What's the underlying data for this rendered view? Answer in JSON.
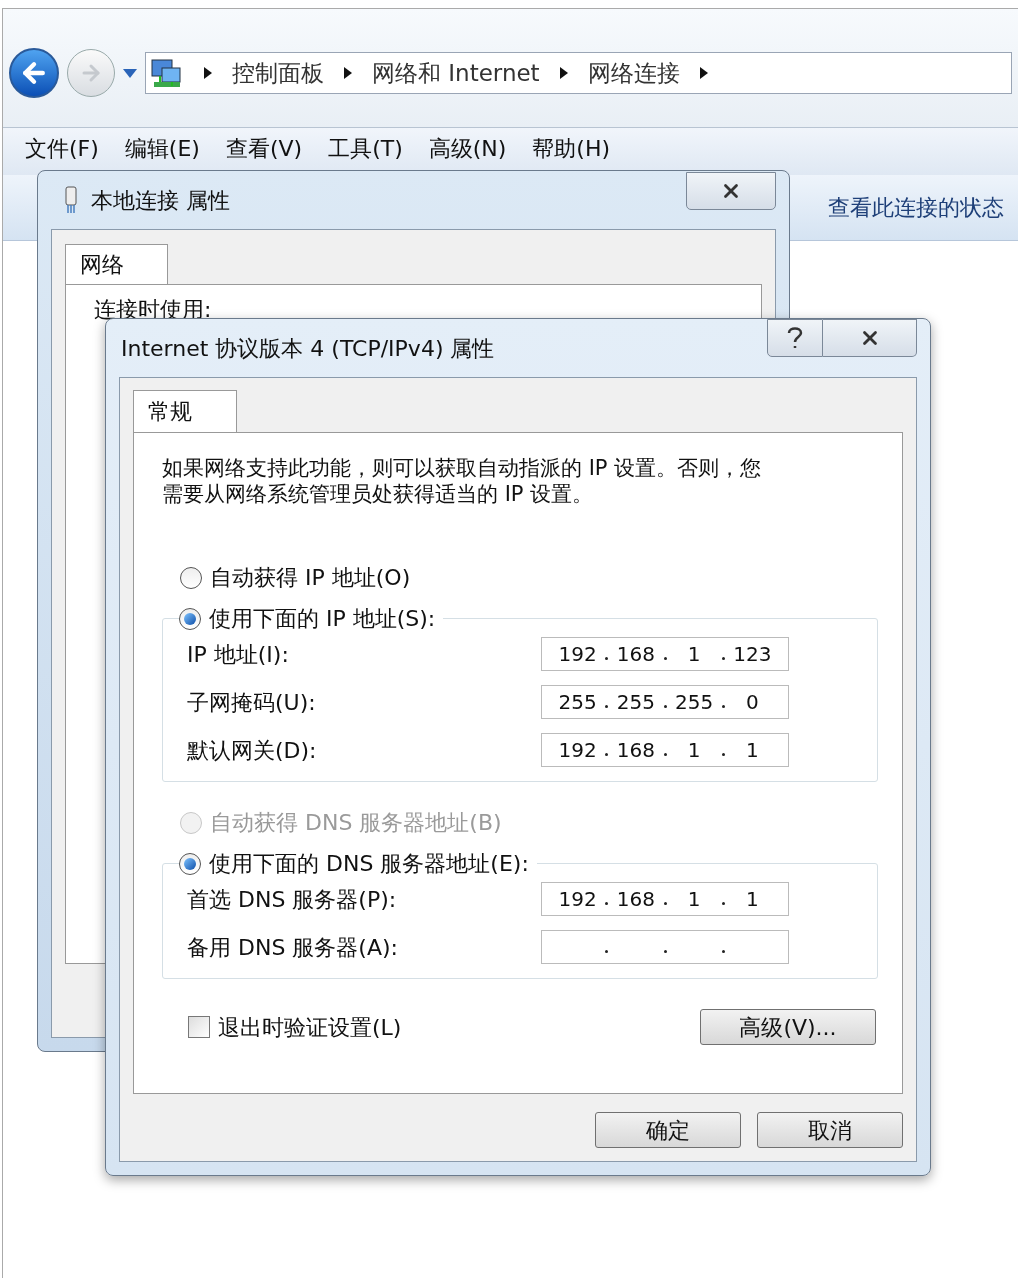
{
  "address_bar": {
    "crumbs": [
      "控制面板",
      "网络和 Internet",
      "网络连接"
    ]
  },
  "menu_bar": {
    "items": [
      "文件(F)",
      "编辑(E)",
      "查看(V)",
      "工具(T)",
      "高级(N)",
      "帮助(H)"
    ]
  },
  "command_bar": {
    "link": "查看此连接的状态"
  },
  "back_dialog": {
    "title": "本地连接 属性",
    "tabs": [
      {
        "label": "网络",
        "selected": true
      }
    ],
    "label": "连接时使用:"
  },
  "dialog": {
    "title": "Internet 协议版本 4 (TCP/IPv4) 属性",
    "tabs": [
      {
        "label": "常规",
        "selected": true
      }
    ],
    "intro": "如果网络支持此功能，则可以获取自动指派的 IP 设置。否则，您需要从网络系统管理员处获得适当的 IP 设置。",
    "ip_mode": [
      {
        "label": "自动获得 IP 地址(O)",
        "selected": false,
        "disabled": false
      },
      {
        "label": "使用下面的 IP 地址(S):",
        "selected": true,
        "disabled": false
      }
    ],
    "ip_fields": [
      {
        "label": "IP 地址(I):",
        "octets": [
          "192",
          "168",
          "1",
          "123"
        ]
      },
      {
        "label": "子网掩码(U):",
        "octets": [
          "255",
          "255",
          "255",
          "0"
        ]
      },
      {
        "label": "默认网关(D):",
        "octets": [
          "192",
          "168",
          "1",
          "1"
        ]
      }
    ],
    "dns_mode": [
      {
        "label": "自动获得 DNS 服务器地址(B)",
        "selected": false,
        "disabled": true
      },
      {
        "label": "使用下面的 DNS 服务器地址(E):",
        "selected": true,
        "disabled": false
      }
    ],
    "dns_fields": [
      {
        "label": "首选 DNS 服务器(P):",
        "octets": [
          "192",
          "168",
          "1",
          "1"
        ]
      },
      {
        "label": "备用 DNS 服务器(A):"
      }
    ],
    "validate": {
      "label": "退出时验证设置(L)",
      "checked": false
    },
    "advanced_button": "高级(V)...",
    "buttons": [
      "确定",
      "取消"
    ]
  }
}
